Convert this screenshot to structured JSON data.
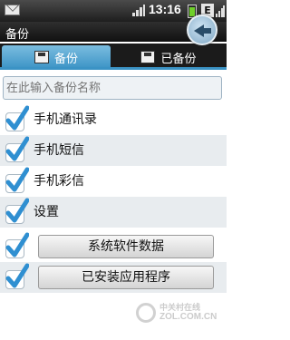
{
  "status_bar": {
    "time": "13:16",
    "network_badge": "E",
    "icons": [
      "mail-icon",
      "signal-icon",
      "battery-icon",
      "signal-icon"
    ]
  },
  "title_bar": {
    "title": "备份",
    "back_icon": "back-arrow-icon"
  },
  "tabs": [
    {
      "label": "备份",
      "icon": "disk-download-icon",
      "active": true
    },
    {
      "label": "已备份",
      "icon": "disk-icon",
      "active": false
    }
  ],
  "search": {
    "placeholder": "在此输入备份名称"
  },
  "items": [
    {
      "label": "手机通讯录",
      "checked": true,
      "type": "text"
    },
    {
      "label": "手机短信",
      "checked": true,
      "type": "text"
    },
    {
      "label": "手机彩信",
      "checked": true,
      "type": "text"
    },
    {
      "label": "设置",
      "checked": true,
      "type": "text"
    },
    {
      "label": "系统软件数据",
      "checked": true,
      "type": "button"
    },
    {
      "label": "已安装应用程序",
      "checked": true,
      "type": "button"
    }
  ],
  "watermark": {
    "cn": "中关村在线",
    "en": "ZOL.COM.CN"
  },
  "colors": {
    "accent": "#3b93c5",
    "check": "#2f8fd1"
  }
}
